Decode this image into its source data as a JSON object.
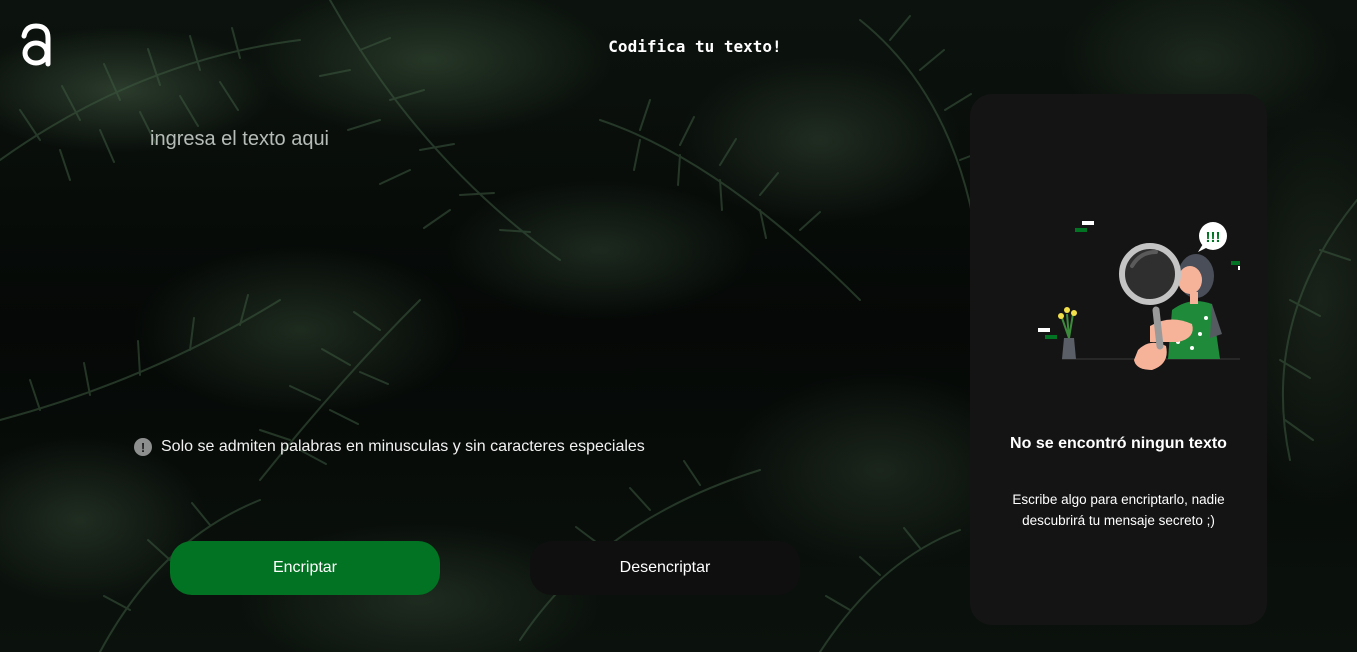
{
  "header": {
    "logo_icon": "alura-a-logo-icon",
    "title": "Codifica tu texto!"
  },
  "input": {
    "placeholder": "ingresa el texto aqui",
    "value": ""
  },
  "hint": {
    "icon": "exclamation-circle-icon",
    "text": "Solo se admiten palabras en minusculas y sin caracteres especiales"
  },
  "buttons": {
    "encrypt_label": "Encriptar",
    "decrypt_label": "Desencriptar"
  },
  "output": {
    "illustration": "woman-with-magnifying-glass-illustration",
    "empty_title": "No se encontró ningun texto",
    "empty_description": "Escribe algo para encriptarlo, nadie descubrirá tu mensaje secreto ;)"
  },
  "colors": {
    "primary": "#027322",
    "secondary_button": "#0f0f0f",
    "panel": "#141414",
    "text": "#ffffff"
  }
}
